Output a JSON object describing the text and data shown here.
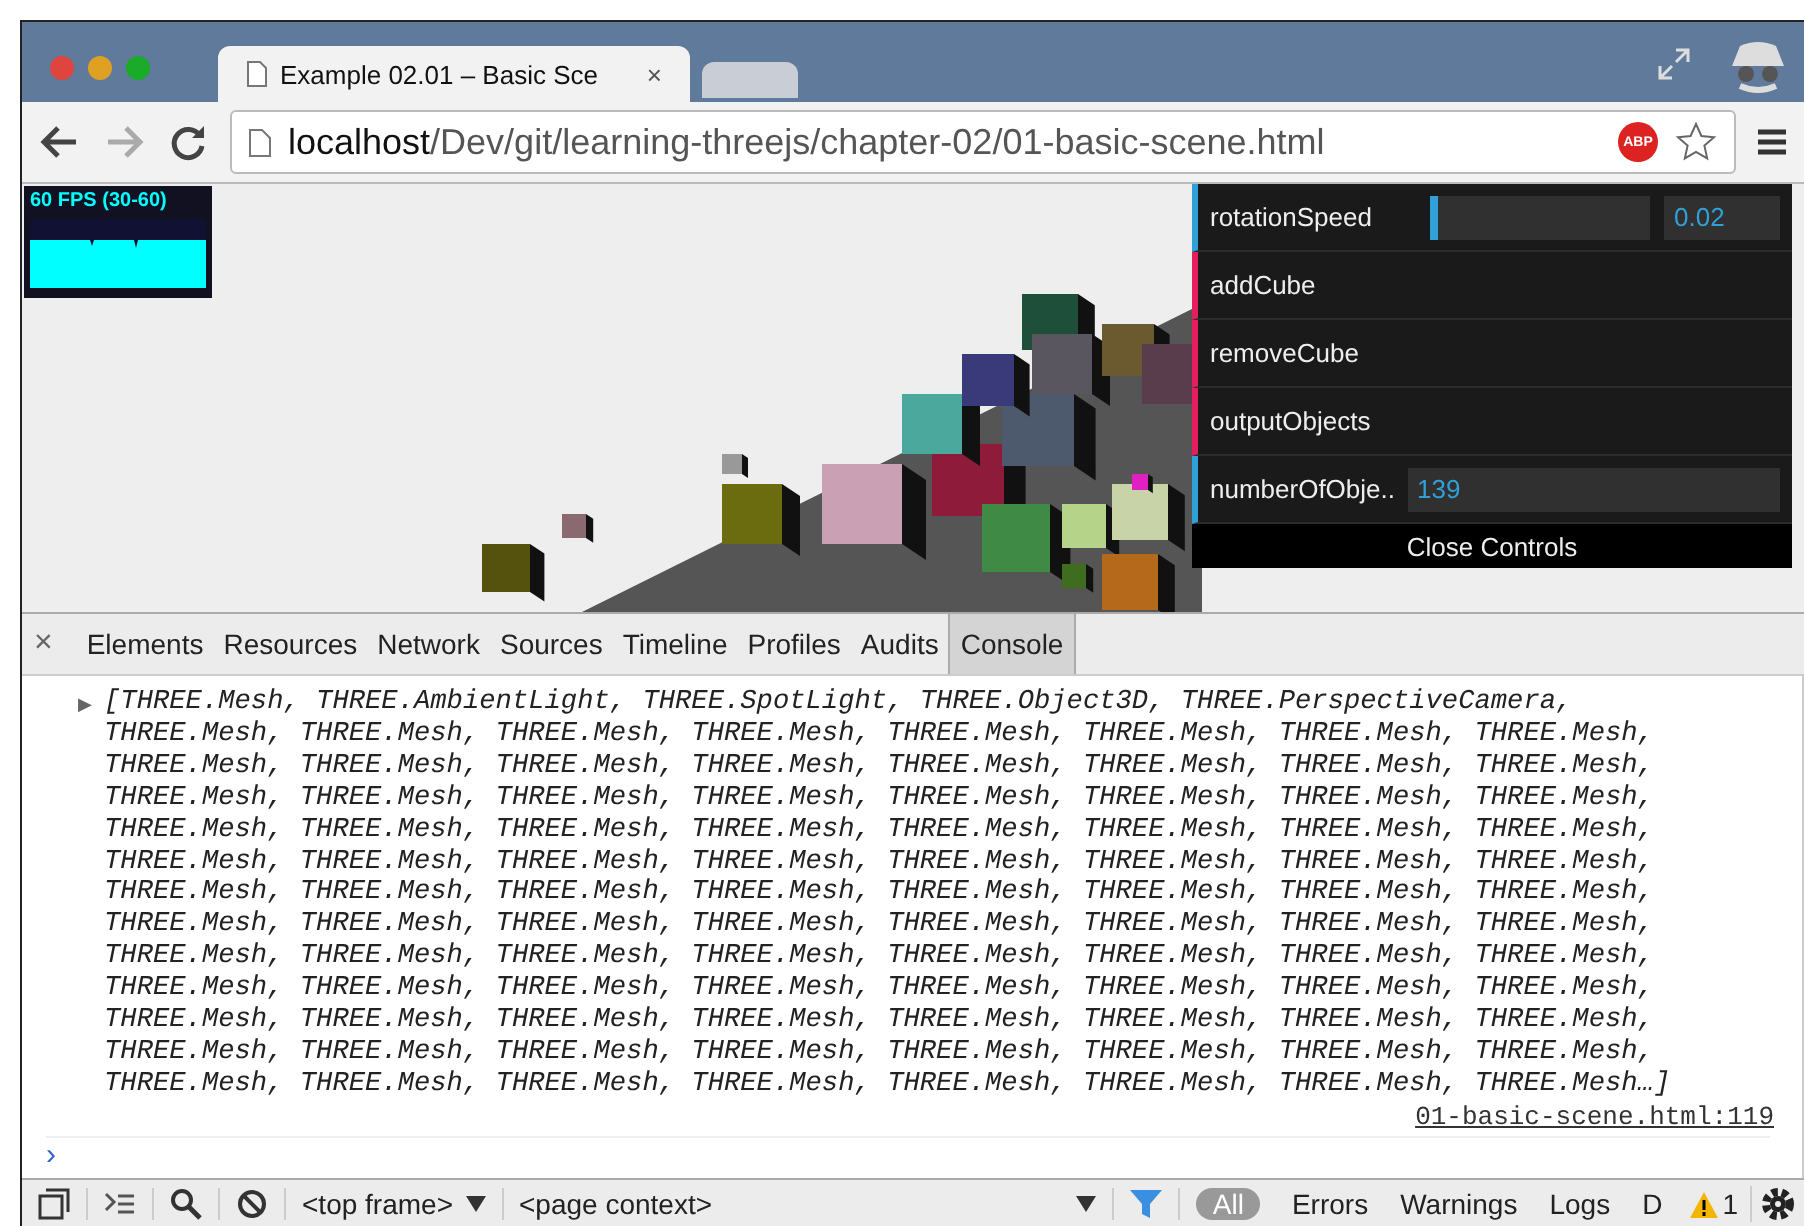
{
  "tabs": [
    {
      "title": "Example 02.01 – Basic Sce",
      "close": "×",
      "selected": true
    },
    {
      "selected": false
    }
  ],
  "address_bar": {
    "host": "localhost",
    "path": "/Dev/git/learning-threejs/chapter-02/01-basic-scene.html"
  },
  "extension_badge": "ABP",
  "stats": {
    "label": "60 FPS (30-60)"
  },
  "controls": [
    {
      "kind": "slider",
      "label": "rotationSpeed",
      "level": 0.04,
      "value": "0.02"
    },
    {
      "kind": "function",
      "label": "addCube"
    },
    {
      "kind": "function",
      "label": "removeCube"
    },
    {
      "kind": "function",
      "label": "outputObjects"
    },
    {
      "kind": "number",
      "label": "numberOfObje..",
      "value": "139"
    }
  ],
  "close_controls": "Close Controls",
  "devtools": {
    "close": "×",
    "tabs": [
      {
        "label": "Elements",
        "selected": false
      },
      {
        "label": "Resources",
        "selected": false
      },
      {
        "label": "Network",
        "selected": false
      },
      {
        "label": "Sources",
        "selected": false
      },
      {
        "label": "Timeline",
        "selected": false
      },
      {
        "label": "Profiles",
        "selected": false
      },
      {
        "label": "Audits",
        "selected": false
      },
      {
        "label": "Console",
        "selected": true
      }
    ]
  },
  "console": {
    "expander": "▶",
    "lines": [
      "[THREE.Mesh, THREE.AmbientLight, THREE.SpotLight, THREE.Object3D, THREE.PerspectiveCamera,",
      "THREE.Mesh, THREE.Mesh, THREE.Mesh, THREE.Mesh, THREE.Mesh, THREE.Mesh, THREE.Mesh, THREE.Mesh,",
      "THREE.Mesh, THREE.Mesh, THREE.Mesh, THREE.Mesh, THREE.Mesh, THREE.Mesh, THREE.Mesh, THREE.Mesh,",
      "THREE.Mesh, THREE.Mesh, THREE.Mesh, THREE.Mesh, THREE.Mesh, THREE.Mesh, THREE.Mesh, THREE.Mesh,",
      "THREE.Mesh, THREE.Mesh, THREE.Mesh, THREE.Mesh, THREE.Mesh, THREE.Mesh, THREE.Mesh, THREE.Mesh,",
      "THREE.Mesh, THREE.Mesh, THREE.Mesh, THREE.Mesh, THREE.Mesh, THREE.Mesh, THREE.Mesh, THREE.Mesh,",
      "THREE.Mesh, THREE.Mesh, THREE.Mesh, THREE.Mesh, THREE.Mesh, THREE.Mesh, THREE.Mesh, THREE.Mesh,",
      "THREE.Mesh, THREE.Mesh, THREE.Mesh, THREE.Mesh, THREE.Mesh, THREE.Mesh, THREE.Mesh, THREE.Mesh,",
      "THREE.Mesh, THREE.Mesh, THREE.Mesh, THREE.Mesh, THREE.Mesh, THREE.Mesh, THREE.Mesh, THREE.Mesh,",
      "THREE.Mesh, THREE.Mesh, THREE.Mesh, THREE.Mesh, THREE.Mesh, THREE.Mesh, THREE.Mesh, THREE.Mesh,",
      "THREE.Mesh, THREE.Mesh, THREE.Mesh, THREE.Mesh, THREE.Mesh, THREE.Mesh, THREE.Mesh, THREE.Mesh,",
      "THREE.Mesh, THREE.Mesh, THREE.Mesh, THREE.Mesh, THREE.Mesh, THREE.Mesh, THREE.Mesh, THREE.Mesh,",
      "THREE.Mesh, THREE.Mesh, THREE.Mesh, THREE.Mesh, THREE.Mesh, THREE.Mesh, THREE.Mesh, THREE.Mesh…]"
    ],
    "source_link": "01-basic-scene.html:119",
    "prompt": "›"
  },
  "bottom_bar": {
    "frame_select": "<top frame>",
    "context_select": "<page context>",
    "filters": [
      {
        "label": "All",
        "selected": true
      },
      {
        "label": "Errors",
        "selected": false
      },
      {
        "label": "Warnings",
        "selected": false
      },
      {
        "label": "Logs",
        "selected": false
      },
      {
        "label": "D",
        "selected": false
      }
    ],
    "warning_count": "1"
  }
}
